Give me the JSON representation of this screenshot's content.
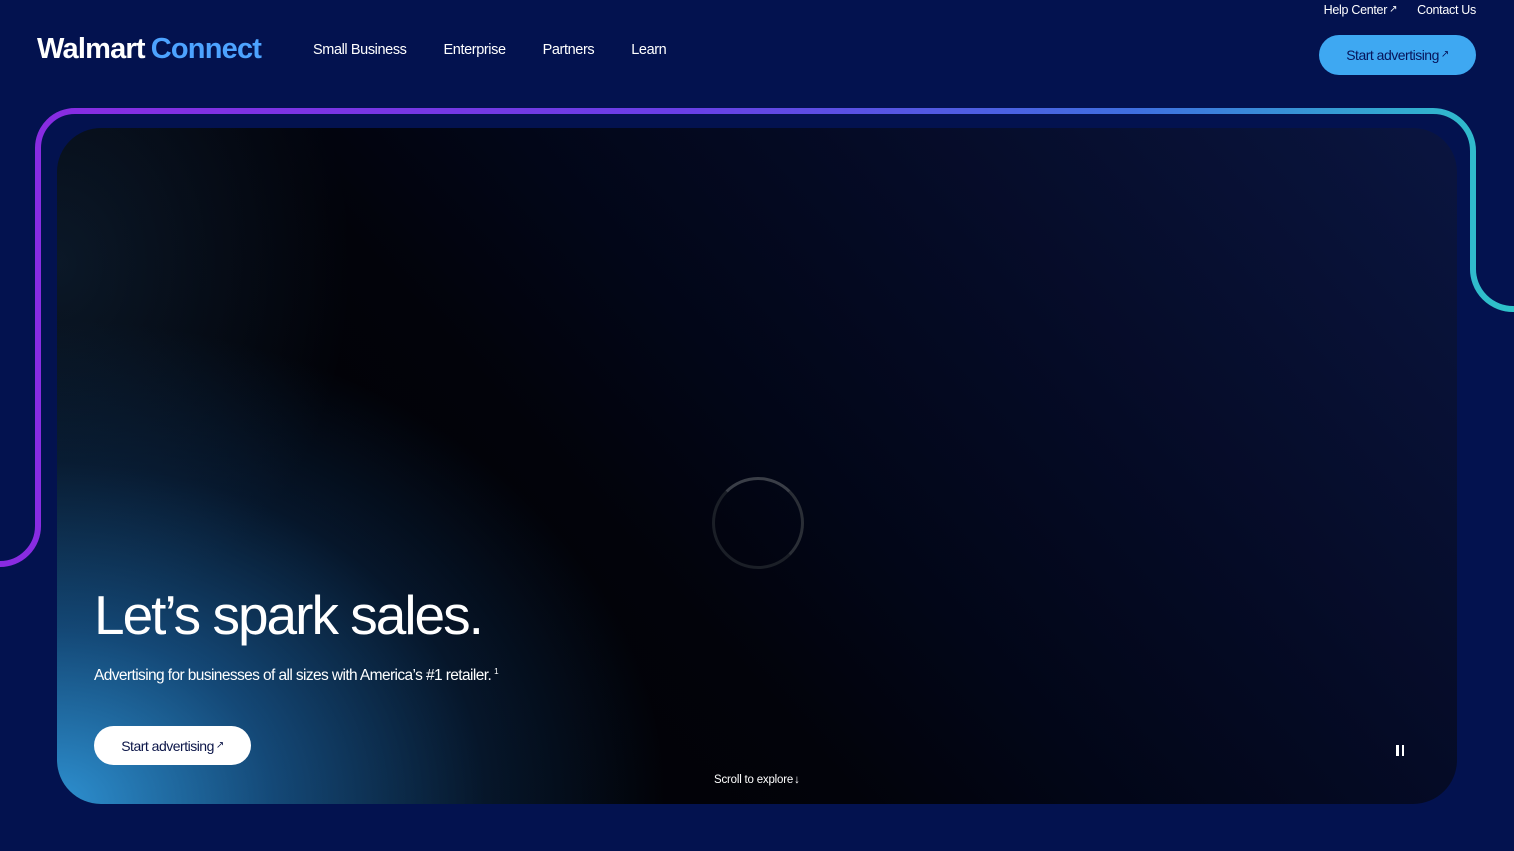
{
  "utility_nav": {
    "help_center": "Help Center",
    "contact_us": "Contact Us",
    "external_icon": "↗"
  },
  "logo": {
    "walmart": "Walmart",
    "connect": "Connect"
  },
  "main_nav": {
    "items": [
      {
        "label": "Small Business"
      },
      {
        "label": "Enterprise"
      },
      {
        "label": "Partners"
      },
      {
        "label": "Learn"
      }
    ]
  },
  "header_cta": {
    "label": "Start advertising",
    "icon": "↗"
  },
  "hero": {
    "headline": "Let’s spark sales.",
    "subhead": "Advertising for businesses of all sizes with America’s #1 retailer.",
    "footnote": "1",
    "cta_label": "Start advertising",
    "cta_icon": "↗",
    "scroll_label": "Scroll to explore",
    "scroll_icon": "↓",
    "pause_icon": "pause-icon",
    "spinner_icon": "loading-spinner-icon"
  },
  "colors": {
    "background": "#03124f",
    "accent_blue": "#3ea8f2",
    "logo_connect": "#4da3ff",
    "frame_purple": "#8a2be2",
    "frame_teal": "#2ec4c9"
  }
}
